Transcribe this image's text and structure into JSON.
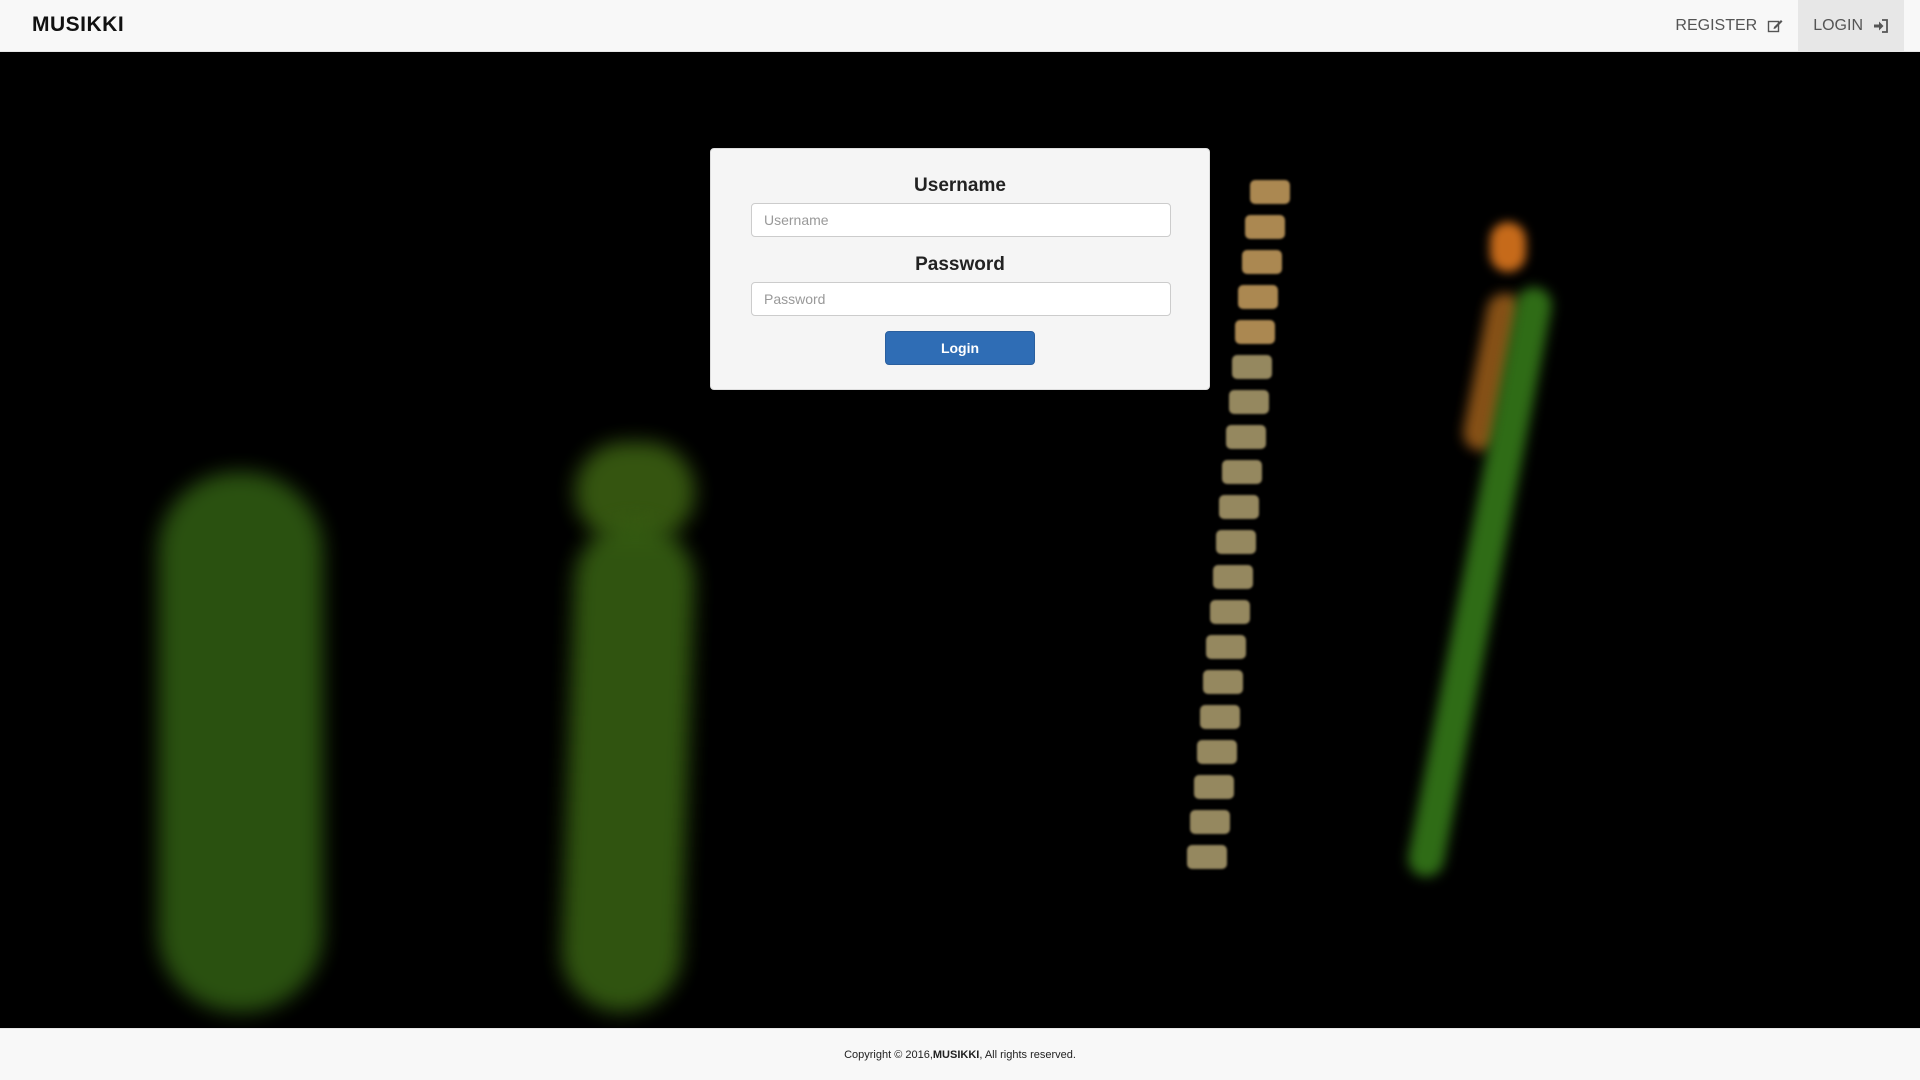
{
  "navbar": {
    "brand": "MUSIKKI",
    "register_label": "REGISTER",
    "register_icon": "edit-icon",
    "login_label": "LOGIN",
    "login_icon": "sign-in-icon"
  },
  "login_form": {
    "username_label": "Username",
    "username_placeholder": "Username",
    "username_value": "",
    "password_label": "Password",
    "password_placeholder": "Password",
    "password_value": "",
    "submit_label": "Login"
  },
  "footer": {
    "prefix": "Copyright © 2016, ",
    "brand": "MUSIKKI",
    "suffix": ", All rights reserved."
  },
  "colors": {
    "navbar_bg": "#f8f8f8",
    "page_bg": "#000000",
    "primary_button": "#2f6db5",
    "card_bg": "#f5f5f5"
  }
}
